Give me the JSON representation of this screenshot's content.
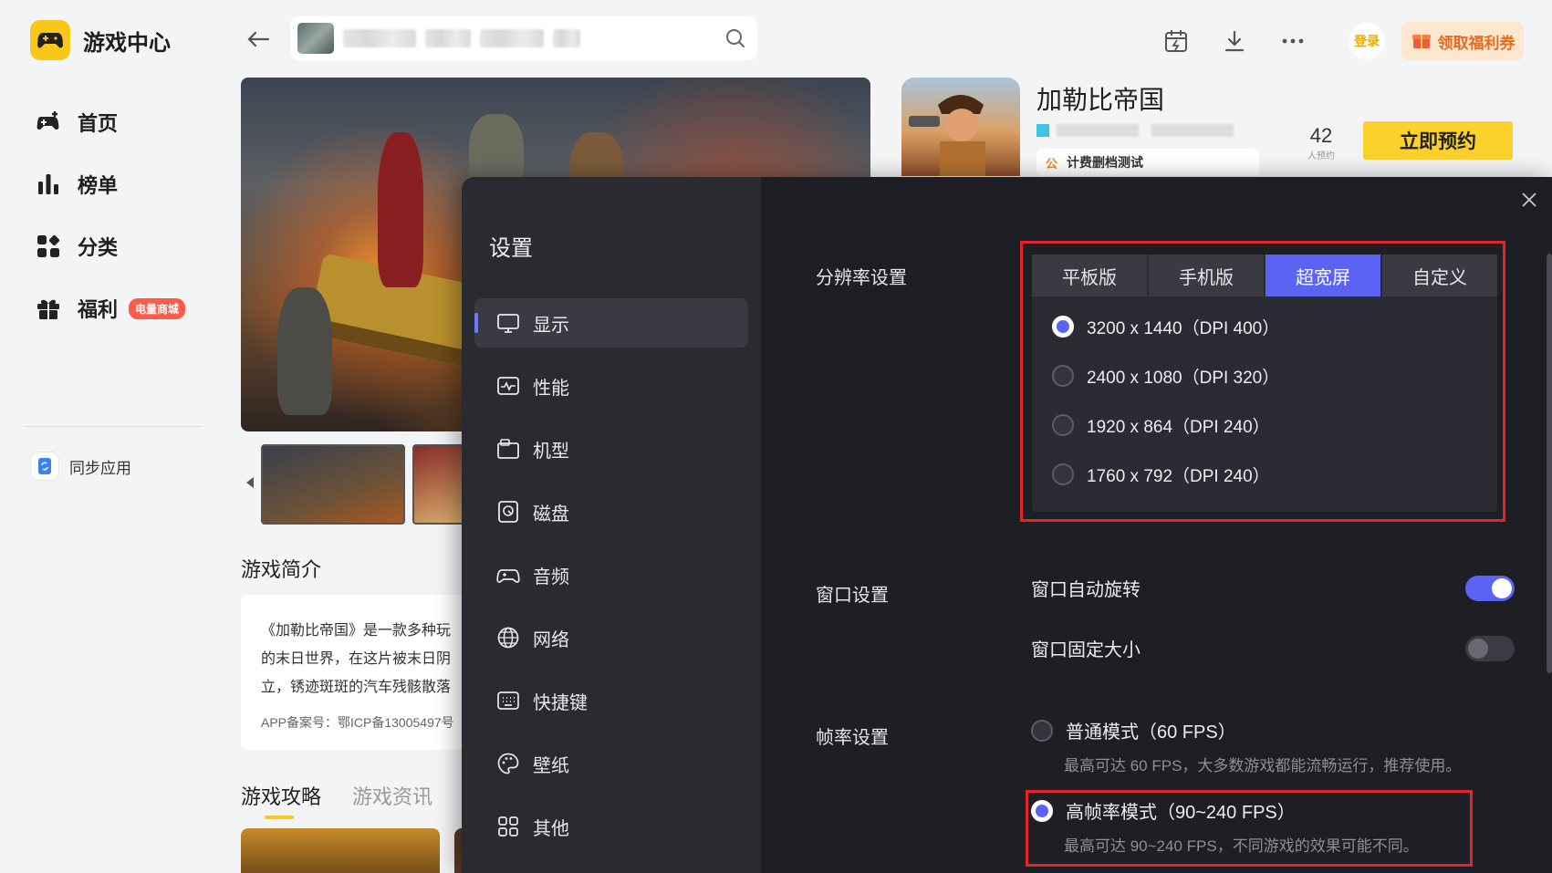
{
  "app": {
    "title": "游戏中心"
  },
  "sidebar": {
    "items": [
      {
        "label": "首页",
        "icon": "gamepad-icon"
      },
      {
        "label": "榜单",
        "icon": "ranking-icon"
      },
      {
        "label": "分类",
        "icon": "category-icon"
      },
      {
        "label": "福利",
        "icon": "gift-icon",
        "badge": "电量商城"
      }
    ],
    "sync_label": "同步应用"
  },
  "topbar": {
    "login_label": "登录",
    "welfare_label": "领取福利券"
  },
  "game": {
    "title": "加勒比帝国",
    "tag": "计费删档测试",
    "reserve_count": "42",
    "reserve_unit": "人预约",
    "reserve_button": "立即预约",
    "intro_title": "游戏简介",
    "intro_lines": [
      "《加勒比帝国》是一款多种玩",
      "的末日世界，在这片被末日阴",
      "立，锈迹斑斑的汽车残骸散落"
    ],
    "icp": "APP备案号：鄂ICP备13005497号",
    "tabs": [
      "游戏攻略",
      "游戏资讯"
    ]
  },
  "settings": {
    "title": "设置",
    "menu": [
      {
        "label": "显示",
        "icon": "monitor-icon",
        "active": true
      },
      {
        "label": "性能",
        "icon": "performance-icon"
      },
      {
        "label": "机型",
        "icon": "device-model-icon"
      },
      {
        "label": "磁盘",
        "icon": "disk-icon"
      },
      {
        "label": "音频",
        "icon": "audio-icon"
      },
      {
        "label": "网络",
        "icon": "globe-icon"
      },
      {
        "label": "快捷键",
        "icon": "keyboard-icon"
      },
      {
        "label": "壁纸",
        "icon": "palette-icon"
      },
      {
        "label": "其他",
        "icon": "grid-icon"
      }
    ],
    "resolution": {
      "label": "分辨率设置",
      "tabs": [
        "平板版",
        "手机版",
        "超宽屏",
        "自定义"
      ],
      "active_tab": "超宽屏",
      "options": [
        {
          "label": "3200 x 1440（DPI 400）",
          "selected": true
        },
        {
          "label": "2400 x 1080（DPI 320）",
          "selected": false
        },
        {
          "label": "1920 x 864（DPI 240）",
          "selected": false
        },
        {
          "label": "1760 x 792（DPI 240）",
          "selected": false
        }
      ]
    },
    "window": {
      "label": "窗口设置",
      "auto_rotate": {
        "label": "窗口自动旋转",
        "on": true
      },
      "fixed_size": {
        "label": "窗口固定大小",
        "on": false
      }
    },
    "fps": {
      "label": "帧率设置",
      "normal": {
        "label": "普通模式（60 FPS）",
        "desc": "最高可达 60 FPS，大多数游戏都能流畅运行，推荐使用。",
        "selected": false
      },
      "high": {
        "label": "高帧率模式（90~240 FPS）",
        "desc": "最高可达 90~240 FPS，不同游戏的效果可能不同。",
        "selected": true
      }
    }
  },
  "colors": {
    "accent": "#5b64f2",
    "highlight_border": "#e3242b",
    "brand_yellow": "#fcd12b"
  }
}
